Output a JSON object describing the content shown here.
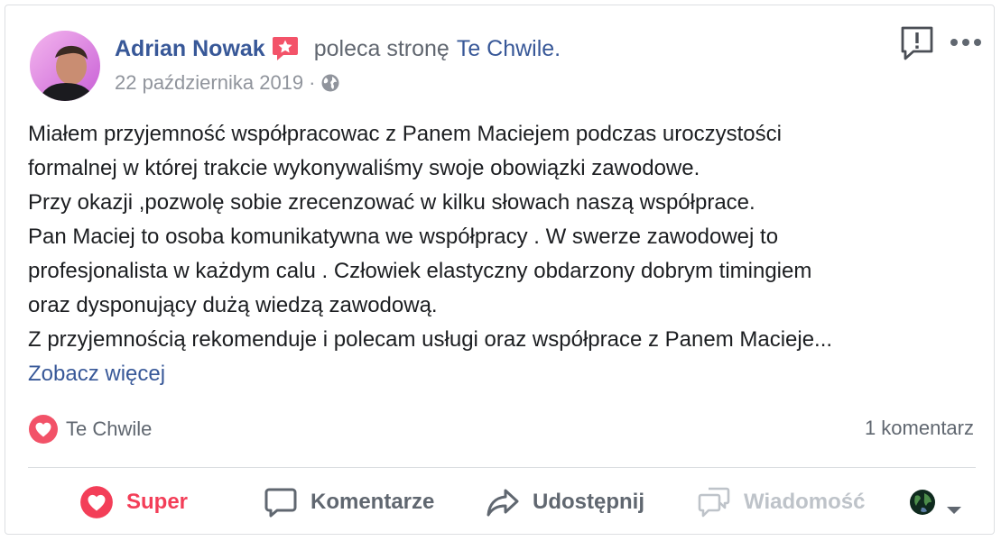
{
  "post": {
    "author": "Adrian Nowak",
    "recommends_text": "poleca stronę",
    "page_name": "Te Chwile.",
    "date": "22 października 2019",
    "meta_separator": "·",
    "audience_icon": "globe-icon",
    "body_lines": [
      "Miałem przyjemność współpracowac z Panem Maciejem podczas uroczystości",
      "formalnej w której trakcie wykonywaliśmy swoje obowiązki zawodowe.",
      "Przy okazji ,pozwolę sobie zrecenzować w kilku słowach naszą współprace.",
      "Pan Maciej to osoba komunikatywna we współpracy . W swerze zawodowej to",
      "profesjonalista w każdym calu . Człowiek elastyczny obdarzony dobrym timingiem",
      "oraz dysponujący dużą wiedzą zawodową.",
      "Z przyjemnością rekomenduje i polecam usługi oraz współprace z Panem Macieje..."
    ],
    "see_more": "Zobacz więcej"
  },
  "reactions": {
    "icon": "heart-reaction-icon",
    "reactor": "Te Chwile",
    "comment_count": "1 komentarz"
  },
  "actions": {
    "super": "Super",
    "comment": "Komentarze",
    "share": "Udostępnij",
    "message": "Wiadomość"
  },
  "colors": {
    "link": "#385898",
    "muted": "#606770",
    "super": "#f33e58",
    "disabled": "#bec3c9",
    "recommend_badge": "#f35369"
  }
}
